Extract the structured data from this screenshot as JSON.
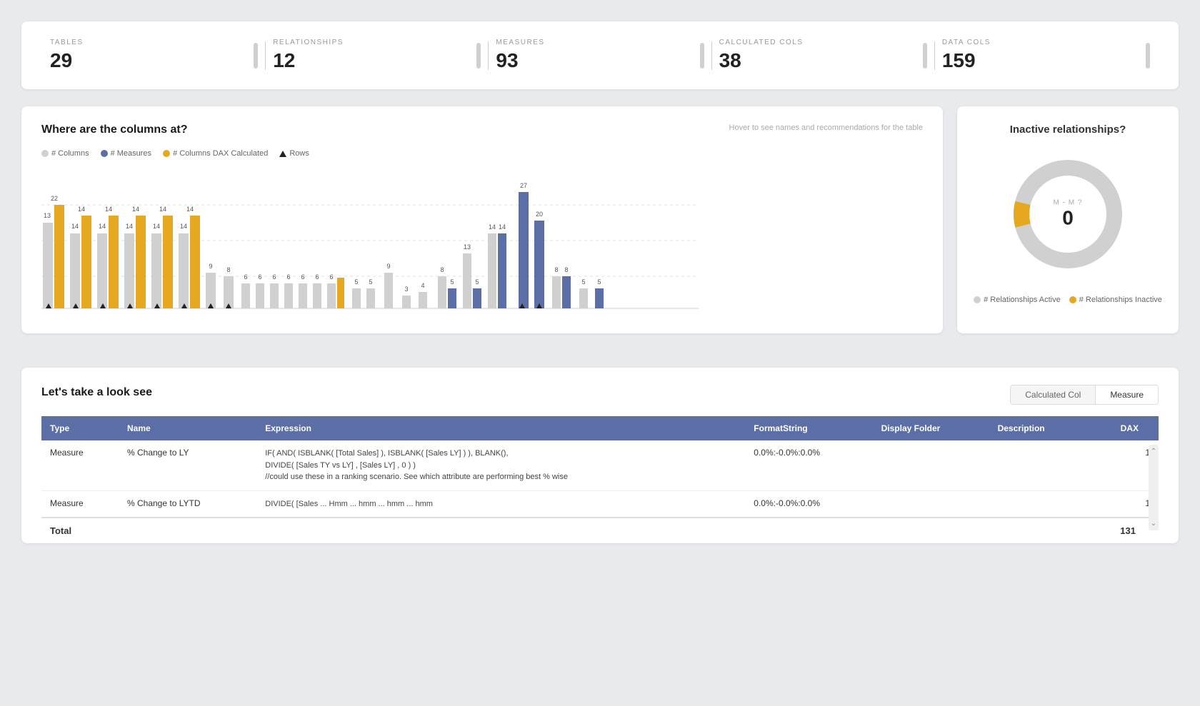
{
  "stats": {
    "items": [
      {
        "label": "TABLES",
        "value": "29"
      },
      {
        "label": "RELATIONSHIPS",
        "value": "12"
      },
      {
        "label": "MEASURES",
        "value": "93"
      },
      {
        "label": "CALCULATED COLS",
        "value": "38"
      },
      {
        "label": "DATA COLS",
        "value": "159"
      }
    ]
  },
  "columnsChart": {
    "title": "Where are the columns at?",
    "subtitle": "Hover to see names and recommendations for the table",
    "legend": [
      {
        "type": "dot",
        "color": "#d0d0d0",
        "label": "# Columns"
      },
      {
        "type": "dot",
        "color": "#5b6fa6",
        "label": "# Measures"
      },
      {
        "type": "dot",
        "color": "#e6a820",
        "label": "# Columns DAX Calculated"
      },
      {
        "type": "triangle",
        "label": "Rows"
      }
    ]
  },
  "donut": {
    "title": "Inactive relationships?",
    "centerLabel": "M - M ?",
    "centerValue": "0",
    "legend": [
      {
        "color": "#d0d0d0",
        "label": "# Relationships Active"
      },
      {
        "color": "#e6a820",
        "label": "# Relationships Inactive"
      }
    ],
    "activePercent": 92,
    "inactivePercent": 8
  },
  "tableSection": {
    "title": "Let's take a look see",
    "tabs": [
      {
        "label": "Calculated Col",
        "active": false
      },
      {
        "label": "Measure",
        "active": true
      }
    ],
    "columns": [
      {
        "key": "type",
        "label": "Type"
      },
      {
        "key": "name",
        "label": "Name"
      },
      {
        "key": "expression",
        "label": "Expression"
      },
      {
        "key": "formatString",
        "label": "FormatString"
      },
      {
        "key": "displayFolder",
        "label": "Display Folder"
      },
      {
        "key": "description",
        "label": "Description"
      },
      {
        "key": "dax",
        "label": "DAX"
      }
    ],
    "rows": [
      {
        "type": "Measure",
        "name": "% Change to LY",
        "expression": "IF( AND( ISBLANK( [Total Sales] ), ISBLANK( [Sales LY] ) ), BLANK(),\nDIVIDE( [Sales TY vs LY] , [Sales LY] , 0 ) )\n//could use these in a ranking scenario. See which attribute are performing best % wise",
        "formatString": "0.0%:-0.0%:0.0%",
        "displayFolder": "",
        "description": "",
        "dax": "1"
      },
      {
        "type": "Measure",
        "name": "% Change to LYTD",
        "expression": "DIVIDE( [Sales ... Hmm ... hmm ... hmm ... hmm",
        "formatString": "0.0%:-0.0%:0.0%",
        "displayFolder": "",
        "description": "",
        "dax": "1"
      }
    ],
    "footer": {
      "label": "Total",
      "value": "131"
    }
  },
  "barData": [
    {
      "grey": 120,
      "orange": 60,
      "blue": 0,
      "greyVal": 13,
      "orangeVal": 22,
      "hasTriangle": true
    },
    {
      "grey": 80,
      "orange": 50,
      "blue": 0,
      "greyVal": 14,
      "orangeVal": 14,
      "hasTriangle": true
    },
    {
      "grey": 80,
      "orange": 50,
      "blue": 0,
      "greyVal": 14,
      "orangeVal": 14,
      "hasTriangle": true
    },
    {
      "grey": 80,
      "orange": 50,
      "blue": 0,
      "greyVal": 14,
      "orangeVal": 14,
      "hasTriangle": true
    },
    {
      "grey": 80,
      "orange": 50,
      "blue": 0,
      "greyVal": 14,
      "orangeVal": 14,
      "hasTriangle": true
    },
    {
      "grey": 80,
      "orange": 50,
      "blue": 0,
      "greyVal": 14,
      "orangeVal": 14,
      "hasTriangle": true
    },
    {
      "grey": 50,
      "orange": 0,
      "blue": 0,
      "greyVal": 9,
      "hasTriangle": false
    },
    {
      "grey": 45,
      "orange": 0,
      "blue": 0,
      "greyVal": 8,
      "hasTriangle": false
    },
    {
      "grey": 35,
      "orange": 0,
      "blue": 0,
      "greyVal": 6,
      "hasTriangle": false
    },
    {
      "grey": 35,
      "orange": 0,
      "blue": 0,
      "greyVal": 6,
      "hasTriangle": false
    },
    {
      "grey": 35,
      "orange": 0,
      "blue": 0,
      "greyVal": 6,
      "hasTriangle": false
    },
    {
      "grey": 35,
      "orange": 0,
      "blue": 0,
      "greyVal": 6,
      "hasTriangle": false
    },
    {
      "grey": 35,
      "orange": 0,
      "blue": 0,
      "greyVal": 6,
      "hasTriangle": false
    },
    {
      "grey": 35,
      "orange": 0,
      "blue": 0,
      "greyVal": 6,
      "hasTriangle": false
    },
    {
      "grey": 35,
      "orange": 15,
      "blue": 0,
      "greyVal": 6,
      "hasTriangle": false
    },
    {
      "grey": 30,
      "orange": 0,
      "blue": 0,
      "greyVal": 5,
      "hasTriangle": false
    },
    {
      "grey": 30,
      "orange": 0,
      "blue": 0,
      "greyVal": 5,
      "hasTriangle": false
    },
    {
      "grey": 50,
      "orange": 0,
      "blue": 0,
      "greyVal": 9,
      "hasTriangle": false
    },
    {
      "grey": 20,
      "orange": 0,
      "blue": 0,
      "greyVal": 3,
      "hasTriangle": false
    },
    {
      "grey": 25,
      "orange": 0,
      "blue": 0,
      "greyVal": 4,
      "hasTriangle": false
    },
    {
      "grey": 45,
      "orange": 0,
      "blue": 25,
      "greyVal": 8,
      "blueVal": 5,
      "hasTriangle": false
    },
    {
      "grey": 75,
      "orange": 0,
      "blue": 30,
      "greyVal": 13,
      "blueVal": 5,
      "hasTriangle": false
    },
    {
      "grey": 80,
      "orange": 0,
      "blue": 80,
      "greyVal": 14,
      "blueVal": 14,
      "hasTriangle": false
    },
    {
      "grey": 0,
      "orange": 0,
      "blue": 155,
      "greyVal": 0,
      "blueVal": 27,
      "hasTriangle": false
    },
    {
      "grey": 0,
      "orange": 0,
      "blue": 115,
      "greyVal": 0,
      "blueVal": 20,
      "hasTriangle": false
    },
    {
      "grey": 45,
      "orange": 0,
      "blue": 50,
      "greyVal": 8,
      "blueVal": 8,
      "hasTriangle": false
    },
    {
      "grey": 30,
      "orange": 0,
      "blue": 15,
      "greyVal": 5,
      "blueVal": 0,
      "hasTriangle": false
    },
    {
      "grey": 30,
      "orange": 0,
      "blue": 30,
      "greyVal": 5,
      "blueVal": 5,
      "hasTriangle": false
    }
  ]
}
